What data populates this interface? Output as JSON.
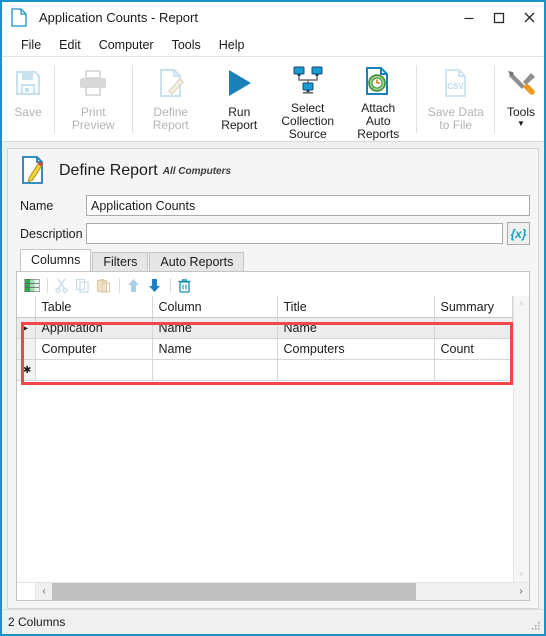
{
  "window": {
    "title": "Application Counts - Report",
    "icon": "document-icon",
    "buttons": {
      "minimize": "minimize-icon",
      "maximize": "maximize-icon",
      "close": "close-icon"
    },
    "border_color": "#1c91c6"
  },
  "menu": {
    "items": [
      {
        "label": "File"
      },
      {
        "label": "Edit"
      },
      {
        "label": "Computer"
      },
      {
        "label": "Tools"
      },
      {
        "label": "Help"
      }
    ]
  },
  "toolbar": {
    "items": [
      {
        "label": "Save",
        "icon": "save-floppy-icon",
        "enabled": false
      },
      {
        "label": "Print Preview",
        "icon": "printer-icon",
        "enabled": false
      },
      {
        "label": "Define Report",
        "icon": "document-pencil-icon",
        "enabled": false
      },
      {
        "label": "Run Report",
        "icon": "play-triangle-icon",
        "enabled": true
      },
      {
        "label": "Select Collection Source",
        "icon": "network-computers-icon",
        "enabled": true
      },
      {
        "label": "Attach Auto Reports",
        "icon": "clock-document-icon",
        "enabled": true
      },
      {
        "label": "Save Data to File",
        "icon": "csv-file-icon",
        "enabled": false
      },
      {
        "label": "Tools",
        "icon": "wrench-screwdriver-icon",
        "enabled": true,
        "dropdown": true
      }
    ]
  },
  "define_report": {
    "heading": "Define Report",
    "scope": "All Computers",
    "icon": "document-pencil-icon",
    "name_label": "Name",
    "name_value": "Application Counts",
    "name_placeholder": "",
    "description_label": "Description",
    "description_value": "",
    "description_placeholder": "",
    "expression_button": "{x}"
  },
  "tabs": [
    {
      "label": "Columns",
      "active": true
    },
    {
      "label": "Filters",
      "active": false
    },
    {
      "label": "Auto Reports",
      "active": false
    }
  ],
  "grid_toolbar": {
    "items": [
      {
        "name": "add-column-icon",
        "enabled": true
      },
      {
        "name": "cut-icon",
        "enabled": false
      },
      {
        "name": "copy-icon",
        "enabled": false
      },
      {
        "name": "paste-icon",
        "enabled": false
      },
      {
        "name": "move-up-icon",
        "enabled": false
      },
      {
        "name": "move-down-icon",
        "enabled": true
      },
      {
        "name": "delete-trash-icon",
        "enabled": true
      }
    ]
  },
  "grid": {
    "columns": [
      "Table",
      "Column",
      "Title",
      "Summary"
    ],
    "rows": [
      {
        "selected": true,
        "indicator": "▸",
        "cells": [
          "Application",
          "Name",
          "Name",
          ""
        ]
      },
      {
        "selected": false,
        "indicator": "",
        "cells": [
          "Computer",
          "Name",
          "Computers",
          "Count"
        ]
      }
    ],
    "new_row_indicator": "✱",
    "scroll": {
      "up_arrow": "˄",
      "down_arrow": "˅",
      "left_arrow": "‹",
      "right_arrow": "›"
    },
    "highlight_color": "#f4454a"
  },
  "status": {
    "text": "2 Columns"
  }
}
